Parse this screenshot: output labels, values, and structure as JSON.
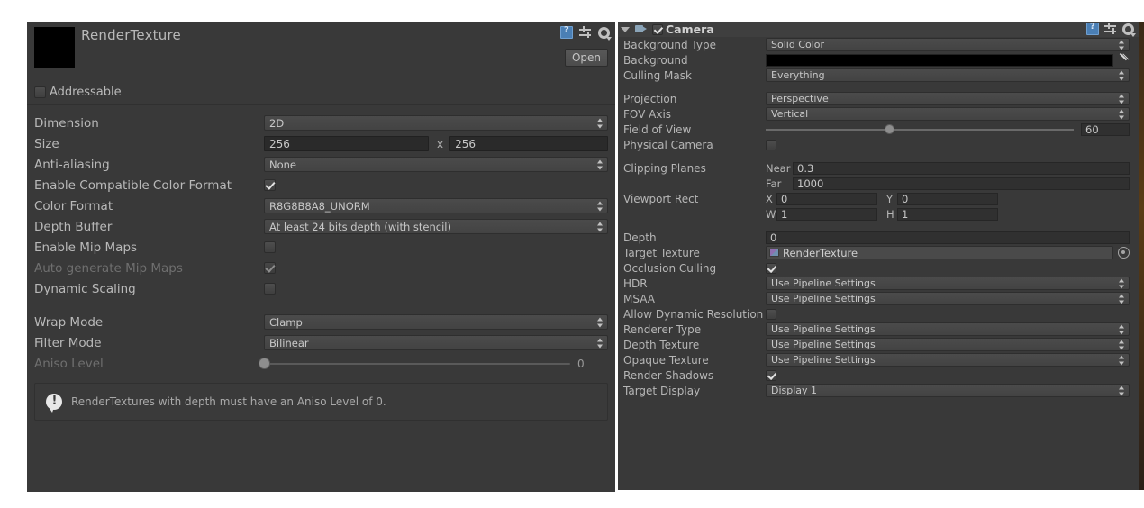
{
  "left_panel": {
    "title": "RenderTexture",
    "open_button": "Open",
    "addressable_label": "Addressable",
    "header_icons": [
      "help-book-icon",
      "preset-icon",
      "settings-gear-icon"
    ],
    "fields": {
      "dimension": {
        "label": "Dimension",
        "value": "2D"
      },
      "size": {
        "label": "Size",
        "width": "256",
        "separator": "x",
        "height": "256"
      },
      "anti_aliasing": {
        "label": "Anti-aliasing",
        "value": "None"
      },
      "enable_compatible_color_format": {
        "label": "Enable Compatible Color Format",
        "checked": true
      },
      "color_format": {
        "label": "Color Format",
        "value": "R8G8B8A8_UNORM"
      },
      "depth_buffer": {
        "label": "Depth Buffer",
        "value": "At least 24 bits depth (with stencil)"
      },
      "enable_mip_maps": {
        "label": "Enable Mip Maps",
        "checked": false
      },
      "auto_generate_mip_maps": {
        "label": "Auto generate Mip Maps",
        "checked": true,
        "disabled": true
      },
      "dynamic_scaling": {
        "label": "Dynamic Scaling",
        "checked": false
      },
      "wrap_mode": {
        "label": "Wrap Mode",
        "value": "Clamp"
      },
      "filter_mode": {
        "label": "Filter Mode",
        "value": "Bilinear"
      },
      "aniso_level": {
        "label": "Aniso Level",
        "value": "0",
        "disabled": true,
        "slider_percent": 0
      }
    },
    "helpbox": {
      "text": "RenderTextures with depth must have an Aniso Level of 0.",
      "icon": "info-warning-icon"
    }
  },
  "right_panel": {
    "component_title": "Camera",
    "component_enabled": true,
    "component_icon": "camera-icon",
    "header_icons": [
      "help-book-icon",
      "preset-icon",
      "settings-gear-icon"
    ],
    "fields": {
      "background_type": {
        "label": "Background Type",
        "value": "Solid Color"
      },
      "background": {
        "label": "Background",
        "color": "#000000"
      },
      "culling_mask": {
        "label": "Culling Mask",
        "value": "Everything"
      },
      "projection": {
        "label": "Projection",
        "value": "Perspective"
      },
      "fov_axis": {
        "label": "FOV Axis",
        "value": "Vertical"
      },
      "field_of_view": {
        "label": "Field of View",
        "value": "60",
        "slider_percent": 40
      },
      "physical_camera": {
        "label": "Physical Camera",
        "checked": false
      },
      "clipping_planes": {
        "label": "Clipping Planes",
        "near_label": "Near",
        "near_value": "0.3",
        "far_label": "Far",
        "far_value": "1000"
      },
      "viewport_rect": {
        "label": "Viewport Rect",
        "x_label": "X",
        "x_value": "0",
        "y_label": "Y",
        "y_value": "0",
        "w_label": "W",
        "w_value": "1",
        "h_label": "H",
        "h_value": "1"
      },
      "depth": {
        "label": "Depth",
        "value": "0"
      },
      "target_texture": {
        "label": "Target Texture",
        "value": "RenderTexture",
        "icon": "render-texture-icon"
      },
      "occlusion_culling": {
        "label": "Occlusion Culling",
        "checked": true
      },
      "hdr": {
        "label": "HDR",
        "value": "Use Pipeline Settings"
      },
      "msaa": {
        "label": "MSAA",
        "value": "Use Pipeline Settings"
      },
      "allow_dynamic_resolution": {
        "label": "Allow Dynamic Resolution",
        "checked": false
      },
      "renderer_type": {
        "label": "Renderer Type",
        "value": "Use Pipeline Settings"
      },
      "depth_texture": {
        "label": "Depth Texture",
        "value": "Use Pipeline Settings"
      },
      "opaque_texture": {
        "label": "Opaque Texture",
        "value": "Use Pipeline Settings"
      },
      "render_shadows": {
        "label": "Render Shadows",
        "checked": true
      },
      "target_display": {
        "label": "Target Display",
        "value": "Display 1"
      }
    }
  }
}
